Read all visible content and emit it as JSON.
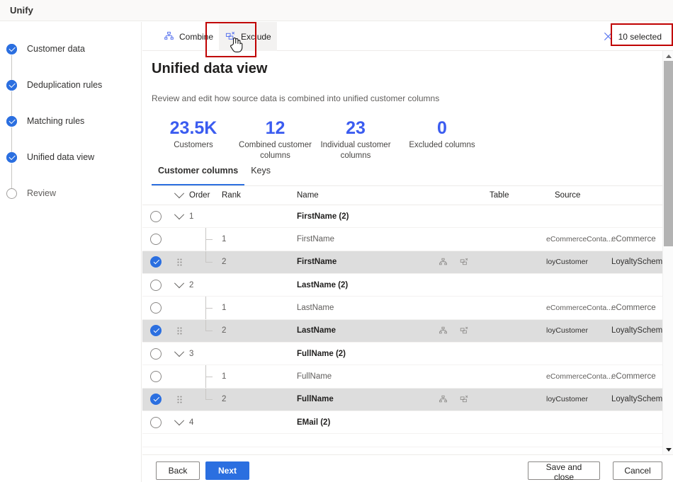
{
  "header": {
    "title": "Unify"
  },
  "wizard": {
    "items": [
      {
        "label": "Customer data",
        "state": "done"
      },
      {
        "label": "Deduplication rules",
        "state": "done"
      },
      {
        "label": "Matching rules",
        "state": "done"
      },
      {
        "label": "Unified data view",
        "state": "done"
      },
      {
        "label": "Review",
        "state": "todo"
      }
    ]
  },
  "commandbar": {
    "combine_label": "Combine",
    "combine_icon": "combine-hierarchy-icon",
    "exclude_label": "Exclude",
    "exclude_icon": "exclude-box-x-icon",
    "selected_label": "10 selected",
    "selected_icon": "close-x-icon",
    "highlight_color": "#c00000"
  },
  "page": {
    "title": "Unified data view",
    "subtitle": "Review and edit how source data is combined into unified customer columns",
    "accent_color": "#3b5cf0"
  },
  "stats": [
    {
      "value": "23.5K",
      "label": "Customers"
    },
    {
      "value": "12",
      "label": "Combined customer columns"
    },
    {
      "value": "23",
      "label": "Individual customer columns"
    },
    {
      "value": "0",
      "label": "Excluded columns"
    }
  ],
  "tabs": [
    {
      "label": "Customer columns",
      "active": true
    },
    {
      "label": "Keys",
      "active": false
    }
  ],
  "table": {
    "columns": {
      "order": "Order",
      "rank": "Rank",
      "name": "Name",
      "table": "Table",
      "source": "Source"
    },
    "rows": [
      {
        "kind": "group",
        "checked": false,
        "order": "1",
        "name": "FirstName (2)"
      },
      {
        "kind": "child",
        "checked": false,
        "rank": "1",
        "name": "FirstName",
        "table": "eCommerceConta...",
        "source": "eCommerce",
        "icons": false
      },
      {
        "kind": "child",
        "checked": true,
        "rank": "2",
        "name": "FirstName",
        "table": "loyCustomer",
        "source": "LoyaltyScheme",
        "icons": true
      },
      {
        "kind": "group",
        "checked": false,
        "order": "2",
        "name": "LastName (2)"
      },
      {
        "kind": "child",
        "checked": false,
        "rank": "1",
        "name": "LastName",
        "table": "eCommerceConta...",
        "source": "eCommerce",
        "icons": false
      },
      {
        "kind": "child",
        "checked": true,
        "rank": "2",
        "name": "LastName",
        "table": "loyCustomer",
        "source": "LoyaltyScheme",
        "icons": true
      },
      {
        "kind": "group",
        "checked": false,
        "order": "3",
        "name": "FullName (2)"
      },
      {
        "kind": "child",
        "checked": false,
        "rank": "1",
        "name": "FullName",
        "table": "eCommerceConta...",
        "source": "eCommerce",
        "icons": false
      },
      {
        "kind": "child",
        "checked": true,
        "rank": "2",
        "name": "FullName",
        "table": "loyCustomer",
        "source": "LoyaltyScheme",
        "icons": true
      },
      {
        "kind": "group",
        "checked": false,
        "order": "4",
        "name": "EMail (2)"
      }
    ]
  },
  "footer": {
    "back": "Back",
    "next": "Next",
    "save_and_close": "Save and close",
    "cancel": "Cancel"
  }
}
